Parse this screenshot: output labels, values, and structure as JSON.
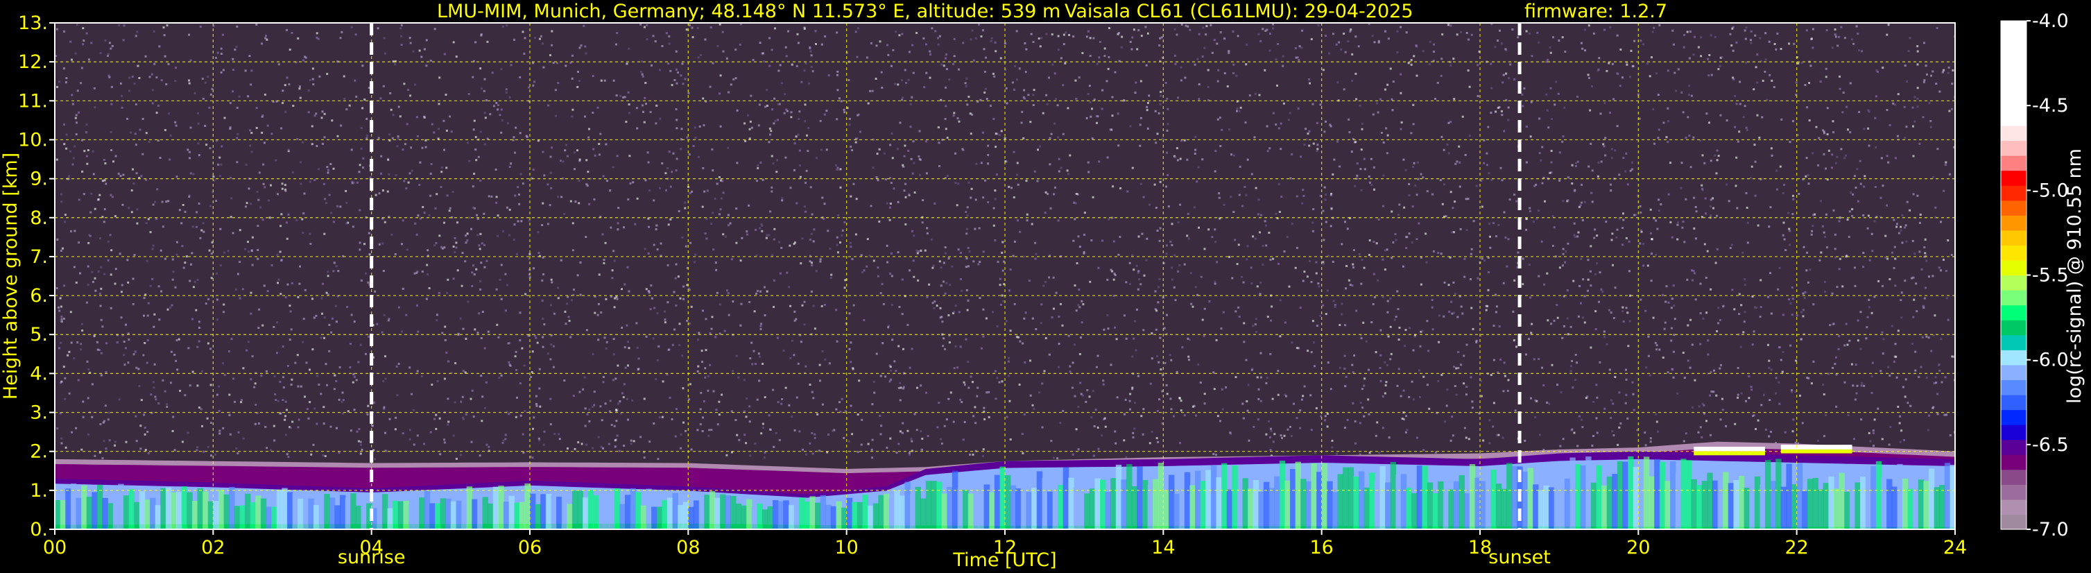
{
  "header": {
    "site": "LMU-MIM, Munich, Germany; 48.148° N 11.573° E, altitude: 539 m",
    "instrument": "Vaisala CL61 (CL61LMU): 29-04-2025",
    "firmware": "firmware: 1.2.7"
  },
  "chart_data": {
    "type": "heatmap",
    "xlabel": "Time [UTC]",
    "ylabel": "Height above ground [km]",
    "xlim": [
      0,
      24
    ],
    "ylim": [
      0,
      13
    ],
    "x_ticks": [
      "00",
      "02",
      "04",
      "06",
      "08",
      "10",
      "12",
      "14",
      "16",
      "18",
      "20",
      "22",
      "24"
    ],
    "y_ticks": [
      "0.",
      "1.",
      "2.",
      "3.",
      "4.",
      "5.",
      "6.",
      "7.",
      "8.",
      "9.",
      "10.",
      "11.",
      "12.",
      "13."
    ],
    "grid": true,
    "grid_color": "#ffff00",
    "markers": [
      {
        "label": "sunrise",
        "time": 4.0
      },
      {
        "label": "sunset",
        "time": 18.5
      }
    ],
    "colorbar": {
      "label": "log(rc-signal) @ 910.55 nm",
      "range": [
        -7.0,
        -4.0
      ],
      "ticks": [
        "-4.0",
        "-4.5",
        "-5.0",
        "-5.5",
        "-6.0",
        "-6.5",
        "-7.0"
      ],
      "ticks_values": [
        -4.0,
        -4.5,
        -5.0,
        -5.5,
        -6.0,
        -6.5,
        -7.0
      ],
      "colors": [
        "#a08aa0",
        "#b090b0",
        "#9c6c9c",
        "#8a4a8a",
        "#780078",
        "#5a0098",
        "#1a00d8",
        "#0028ff",
        "#3060ff",
        "#5a8aff",
        "#8ab0ff",
        "#a0e6ff",
        "#00c8b4",
        "#00c864",
        "#00ff78",
        "#7aff7a",
        "#b4ff5a",
        "#e6ff00",
        "#ffe600",
        "#ffc800",
        "#ff9600",
        "#ff6400",
        "#ff2800",
        "#ff0000",
        "#ff8080",
        "#ffbebe",
        "#ffe6e6",
        "#ffffff",
        "#ffffff",
        "#ffffff",
        "#ffffff",
        "#ffffff",
        "#ffffff",
        "#ffffff"
      ]
    },
    "layers": {
      "background_color": "#3a2c3e",
      "noise_color": "#b8a6d8",
      "aerosol_layer_top_km": [
        [
          0,
          1.8
        ],
        [
          2,
          1.75
        ],
        [
          4,
          1.7
        ],
        [
          6,
          1.72
        ],
        [
          8,
          1.7
        ],
        [
          10,
          1.55
        ],
        [
          11,
          1.6
        ],
        [
          12,
          1.75
        ],
        [
          14,
          1.85
        ],
        [
          16,
          1.9
        ],
        [
          18,
          1.95
        ],
        [
          19,
          2.05
        ],
        [
          20,
          2.1
        ],
        [
          21,
          2.25
        ],
        [
          22,
          2.2
        ],
        [
          23,
          2.1
        ],
        [
          24,
          2.0
        ]
      ],
      "boundary_layer_top_km": [
        [
          0,
          1.3
        ],
        [
          2,
          1.2
        ],
        [
          4,
          1.05
        ],
        [
          6,
          1.25
        ],
        [
          8,
          1.1
        ],
        [
          9.5,
          0.9
        ],
        [
          10.5,
          1.1
        ],
        [
          11,
          1.55
        ],
        [
          12,
          1.75
        ],
        [
          14,
          1.8
        ],
        [
          16,
          1.9
        ],
        [
          18,
          1.8
        ],
        [
          19,
          1.95
        ],
        [
          20,
          2.0
        ],
        [
          22,
          1.9
        ],
        [
          24,
          1.8
        ]
      ],
      "cloud_segments": [
        {
          "start": 20.7,
          "end": 21.6,
          "base_km": 2.0
        },
        {
          "start": 21.8,
          "end": 22.7,
          "base_km": 2.05
        }
      ]
    }
  }
}
